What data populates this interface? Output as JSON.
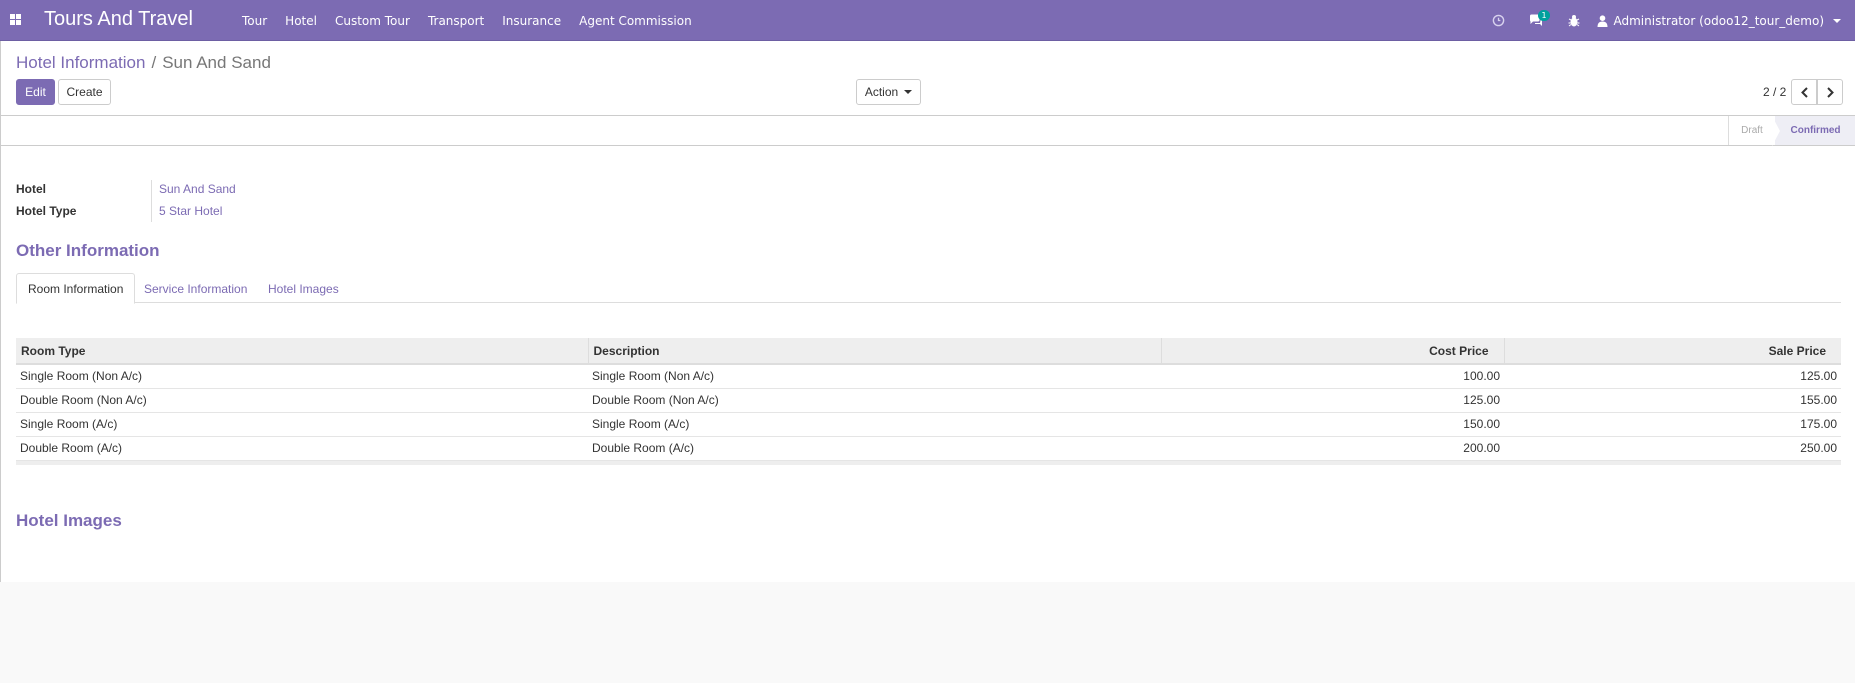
{
  "app": {
    "title": "Tours And Travel",
    "menu": [
      "Tour",
      "Hotel",
      "Custom Tour",
      "Transport",
      "Insurance",
      "Agent Commission"
    ],
    "chat_badge": "1",
    "user": "Administrator (odoo12_tour_demo)"
  },
  "breadcrumb": {
    "parent": "Hotel Information",
    "separator": "/",
    "current": "Sun And Sand"
  },
  "buttons": {
    "edit": "Edit",
    "create": "Create",
    "action": "Action"
  },
  "pager": {
    "text": "2 / 2"
  },
  "status": {
    "stages": [
      "Draft",
      "Confirmed"
    ],
    "active": "Confirmed"
  },
  "fields": {
    "hotel_label": "Hotel",
    "hotel_value": "Sun And Sand",
    "hotel_type_label": "Hotel Type",
    "hotel_type_value": "5 Star Hotel"
  },
  "sections": {
    "other_info": "Other Information",
    "hotel_images": "Hotel Images"
  },
  "tabs": [
    "Room Information",
    "Service Information",
    "Hotel Images"
  ],
  "room_table": {
    "headers": [
      "Room Type",
      "Description",
      "Cost Price",
      "Sale Price"
    ],
    "rows": [
      [
        "Single Room (Non A/c)",
        "Single Room (Non A/c)",
        "100.00",
        "125.00"
      ],
      [
        "Double Room (Non A/c)",
        "Double Room (Non A/c)",
        "125.00",
        "155.00"
      ],
      [
        "Single Room (A/c)",
        "Single Room (A/c)",
        "150.00",
        "175.00"
      ],
      [
        "Double Room (A/c)",
        "Double Room (A/c)",
        "200.00",
        "250.00"
      ]
    ]
  },
  "colors": {
    "brand": "#7c6bb3",
    "badge": "#00a09d"
  }
}
